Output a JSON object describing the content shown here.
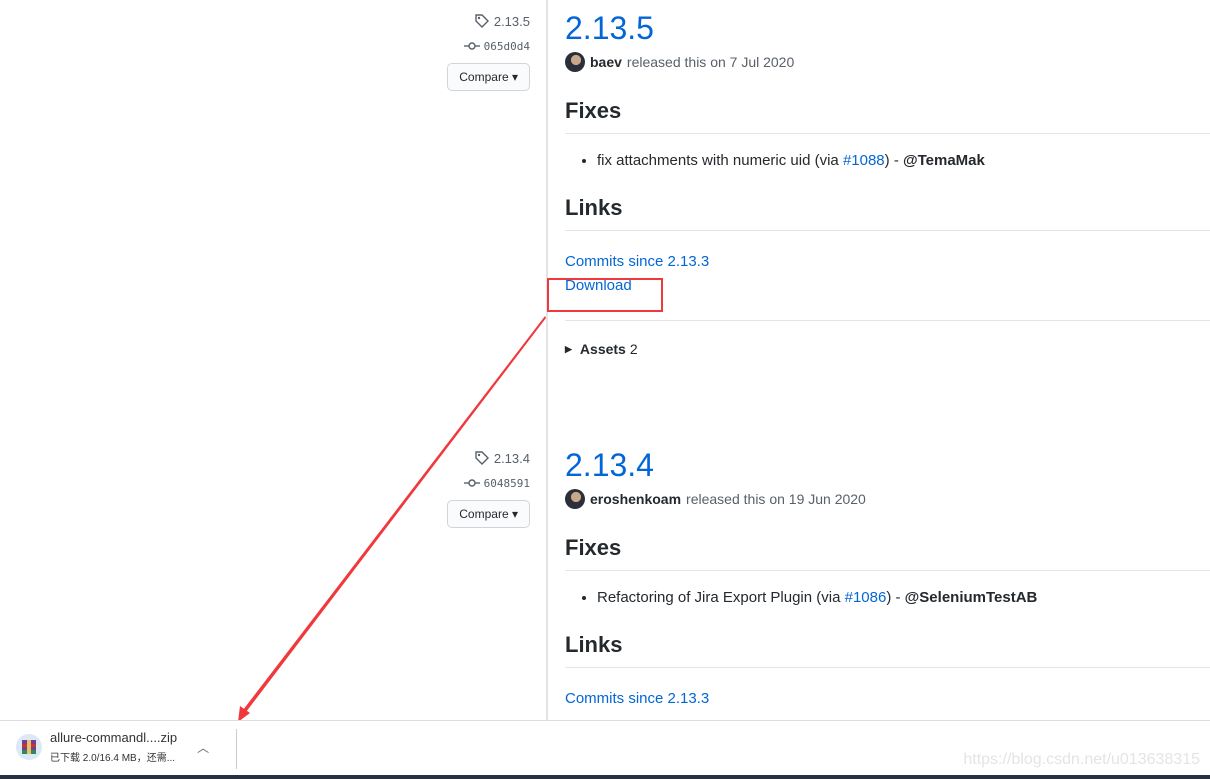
{
  "releases": [
    {
      "tag": "2.13.5",
      "commit": "065d0d4",
      "compare": "Compare",
      "version": "2.13.5",
      "author": "baev",
      "released_text": "released this on 7 Jul 2020",
      "fixes_heading": "Fixes",
      "fix": {
        "text": "fix attachments with numeric uid (via ",
        "link": "#1088",
        "after": ") - ",
        "user": "@TemaMak"
      },
      "links_heading": "Links",
      "commits_link": "Commits since 2.13.3",
      "download_link": "Download",
      "assets_label": "Assets",
      "assets_count": "2"
    },
    {
      "tag": "2.13.4",
      "commit": "6048591",
      "compare": "Compare",
      "version": "2.13.4",
      "author": "eroshenkoam",
      "released_text": "released this on 19 Jun 2020",
      "fixes_heading": "Fixes",
      "fix": {
        "text": "Refactoring of Jira Export Plugin (via ",
        "link": "#1086",
        "after": ") - ",
        "user": "@SeleniumTestAB"
      },
      "links_heading": "Links",
      "commits_link": "Commits since 2.13.3"
    }
  ],
  "download_bar": {
    "filename": "allure-commandl....zip",
    "status": "已下载 2.0/16.4 MB，还需..."
  },
  "watermark": "https://blog.csdn.net/u013638315",
  "colors": {
    "link": "#0366d6",
    "annotation": "#f0393c"
  }
}
